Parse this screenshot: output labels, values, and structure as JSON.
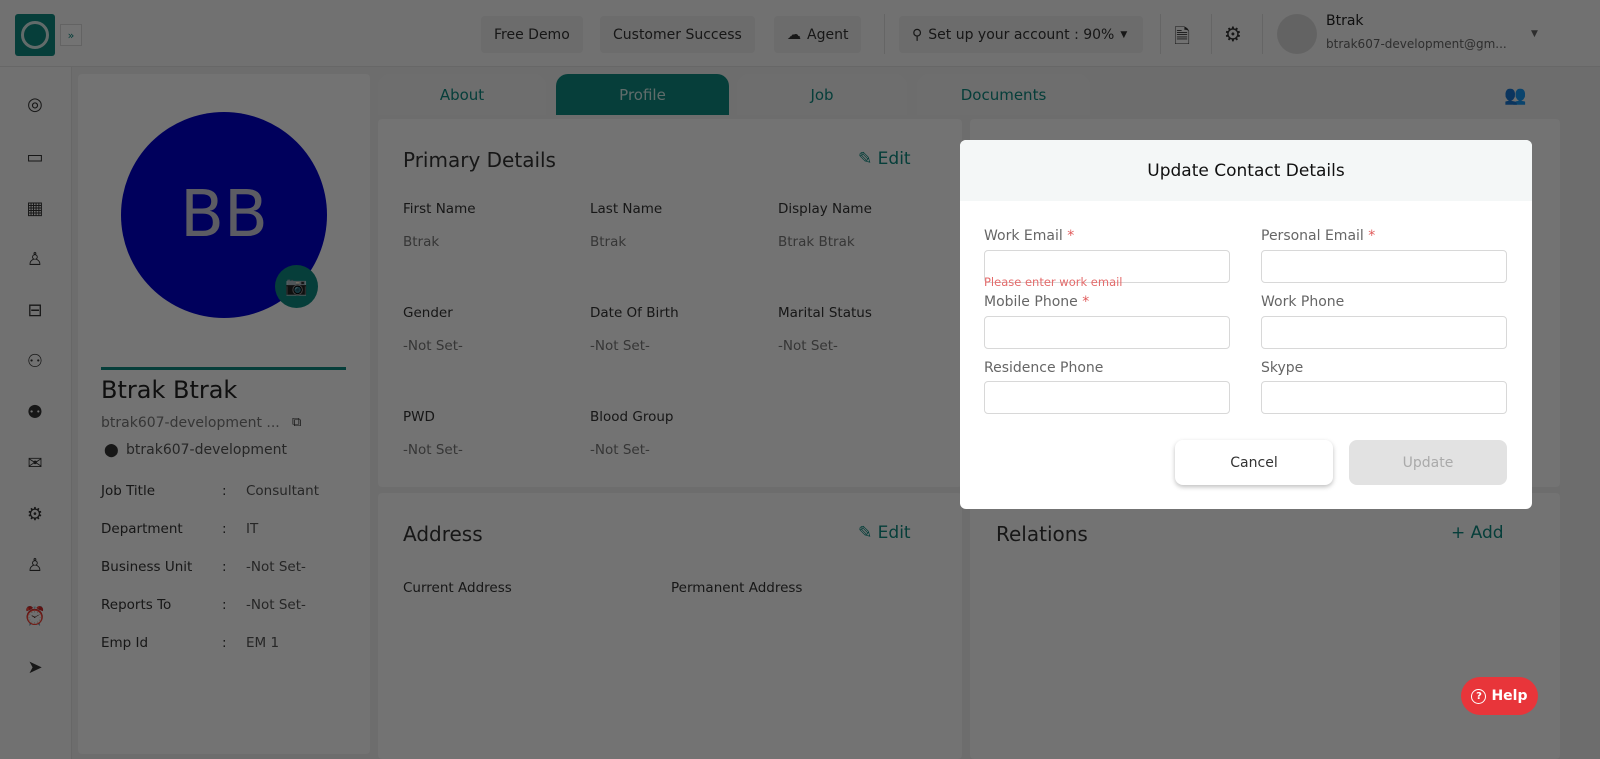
{
  "topbar": {
    "free_demo": "Free Demo",
    "customer_success": "Customer Success",
    "agent": "Agent",
    "setup": "Set up your account : 90%",
    "user_name": "Btrak",
    "user_email": "btrak607-development@gm..."
  },
  "tabs": [
    "About",
    "Profile",
    "Job",
    "Documents"
  ],
  "profile": {
    "initials": "BB",
    "avatar_color": "#0000cc",
    "name": "Btrak Btrak",
    "email": "btrak607-development ...",
    "location": "btrak607-development",
    "fields": [
      {
        "label": "Job Title",
        "value": "Consultant"
      },
      {
        "label": "Department",
        "value": "IT"
      },
      {
        "label": "Business Unit",
        "value": "-Not Set-"
      },
      {
        "label": "Reports To",
        "value": "-Not Set-"
      },
      {
        "label": "Emp Id",
        "value": "EM 1"
      }
    ]
  },
  "primary": {
    "title": "Primary Details",
    "edit": "Edit",
    "fields": [
      {
        "label": "First Name",
        "value": "Btrak"
      },
      {
        "label": "Last Name",
        "value": "Btrak"
      },
      {
        "label": "Display Name",
        "value": "Btrak Btrak"
      },
      {
        "label": "Gender",
        "value": "-Not Set-"
      },
      {
        "label": "Date Of Birth",
        "value": "-Not Set-"
      },
      {
        "label": "Marital Status",
        "value": "-Not Set-"
      },
      {
        "label": "PWD",
        "value": "-Not Set-"
      },
      {
        "label": "Blood Group",
        "value": "-Not Set-"
      }
    ]
  },
  "address": {
    "title": "Address",
    "edit": "Edit",
    "current": "Current Address",
    "permanent": "Permanent Address"
  },
  "relations": {
    "title": "Relations",
    "add": "Add"
  },
  "modal": {
    "title": "Update Contact Details",
    "work_email": "Work Email",
    "personal_email": "Personal Email",
    "mobile_phone": "Mobile Phone",
    "work_phone": "Work Phone",
    "residence_phone": "Residence Phone",
    "skype": "Skype",
    "required_mark": "*",
    "error": "Please enter work email",
    "cancel": "Cancel",
    "update": "Update"
  },
  "help": "Help",
  "colors": {
    "accent": "#0d8a80",
    "error": "#e05a5a",
    "help": "#e8353a"
  }
}
